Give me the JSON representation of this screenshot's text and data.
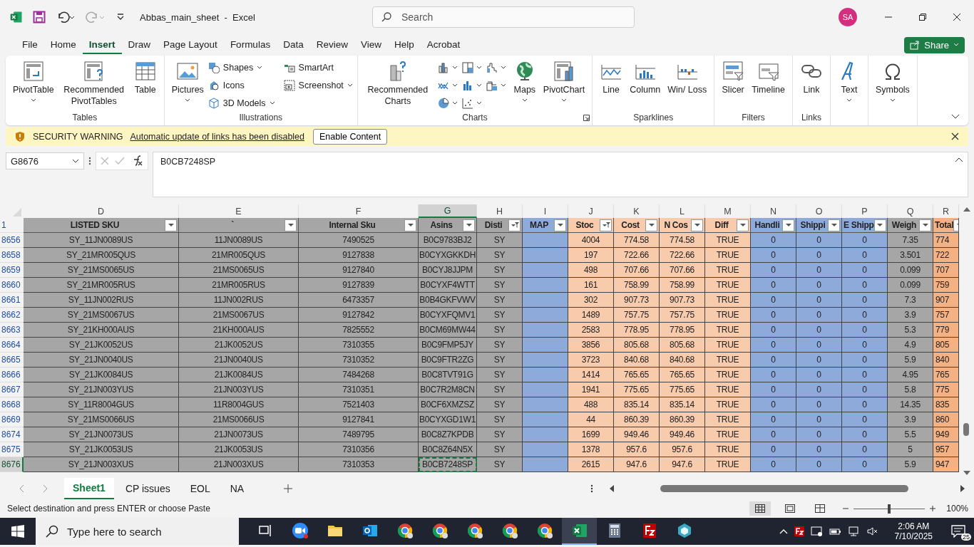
{
  "title_bar": {
    "title": "Abbas_main_sheet  -  Excel",
    "search_placeholder": "Search",
    "avatar": "SA"
  },
  "menu_tabs": [
    {
      "label": "File",
      "selected": false
    },
    {
      "label": "Home",
      "selected": false
    },
    {
      "label": "Insert",
      "selected": true
    },
    {
      "label": "Draw",
      "selected": false
    },
    {
      "label": "Page Layout",
      "selected": false
    },
    {
      "label": "Formulas",
      "selected": false
    },
    {
      "label": "Data",
      "selected": false
    },
    {
      "label": "Review",
      "selected": false
    },
    {
      "label": "View",
      "selected": false
    },
    {
      "label": "Help",
      "selected": false
    },
    {
      "label": "Acrobat",
      "selected": false
    }
  ],
  "share_button": "Share",
  "ribbon": {
    "groups": [
      {
        "label": "Tables",
        "items": [
          {
            "kind": "large",
            "label": "PivotTable",
            "dropdown": true
          },
          {
            "kind": "large",
            "label": "Recommended PivotTables",
            "dropdown": false
          },
          {
            "kind": "large",
            "label": "Table",
            "dropdown": false
          }
        ]
      },
      {
        "label": "Illustrations",
        "items": [
          {
            "kind": "large",
            "label": "Pictures",
            "dropdown": true
          },
          {
            "kind": "small",
            "label": "Shapes",
            "dropdown": true
          },
          {
            "kind": "small",
            "label": "Icons",
            "dropdown": false
          },
          {
            "kind": "small",
            "label": "3D Models",
            "dropdown": true
          },
          {
            "kind": "small",
            "label": "SmartArt",
            "dropdown": false
          },
          {
            "kind": "small",
            "label": "Screenshot",
            "dropdown": true
          }
        ]
      },
      {
        "label": "Charts",
        "launcher": true,
        "items": [
          {
            "kind": "large",
            "label": "Recommended Charts",
            "dropdown": false
          },
          {
            "kind": "gallery"
          },
          {
            "kind": "large",
            "label": "Maps",
            "dropdown": true
          },
          {
            "kind": "large",
            "label": "PivotChart",
            "dropdown": true
          }
        ]
      },
      {
        "label": "Sparklines",
        "items": [
          {
            "kind": "large",
            "label": "Line",
            "dropdown": false
          },
          {
            "kind": "large",
            "label": "Column",
            "dropdown": false
          },
          {
            "kind": "large",
            "label": "Win/ Loss",
            "dropdown": false
          }
        ]
      },
      {
        "label": "Filters",
        "items": [
          {
            "kind": "large",
            "label": "Slicer",
            "dropdown": false
          },
          {
            "kind": "large",
            "label": "Timeline",
            "dropdown": false
          }
        ]
      },
      {
        "label": "Links",
        "items": [
          {
            "kind": "large",
            "label": "Link",
            "dropdown": false
          }
        ]
      },
      {
        "items": [
          {
            "kind": "large",
            "label": "Text",
            "dropdown": true
          }
        ]
      },
      {
        "items": [
          {
            "kind": "large",
            "label": "Symbols",
            "dropdown": true
          }
        ]
      }
    ]
  },
  "security_bar": {
    "title": "SECURITY WARNING",
    "message": "Automatic update of links has been disabled",
    "button": "Enable Content"
  },
  "formula_bar": {
    "name_box": "G8676",
    "value": "B0CB7248SP"
  },
  "sheet": {
    "header_row": "1",
    "columns": [
      {
        "letter": "D",
        "header": "LISTED SKU",
        "color": "#a6a6a6",
        "filtered": false,
        "selected": false
      },
      {
        "letter": "E",
        "header": "`",
        "color": "#a6a6a6",
        "filtered": false,
        "selected": false
      },
      {
        "letter": "F",
        "header": "Internal Sku",
        "color": "#a6a6a6",
        "filtered": false,
        "selected": false
      },
      {
        "letter": "G",
        "header": "Asins",
        "color": "#a6a6a6",
        "filtered": false,
        "selected": true
      },
      {
        "letter": "H",
        "header": "Disti",
        "color": "#a6a6a6",
        "filtered": true,
        "selected": false
      },
      {
        "letter": "I",
        "header": "MAP",
        "color": "#8eaadb",
        "filtered": false,
        "selected": false
      },
      {
        "letter": "J",
        "header": "Stoc",
        "color": "#f8cbad",
        "filtered": true,
        "selected": false
      },
      {
        "letter": "K",
        "header": "Cost",
        "color": "#f8cbad",
        "filtered": false,
        "selected": false
      },
      {
        "letter": "L",
        "header": "N Cos",
        "color": "#f8cbad",
        "filtered": false,
        "selected": false
      },
      {
        "letter": "M",
        "header": "Diff",
        "color": "#f8cbad",
        "filtered": false,
        "selected": false
      },
      {
        "letter": "N",
        "header": "Handli",
        "color": "#8eaadb",
        "filtered": false,
        "selected": false
      },
      {
        "letter": "O",
        "header": "Shippi",
        "color": "#8eaadb",
        "filtered": false,
        "selected": false
      },
      {
        "letter": "P",
        "header": "E Shipp",
        "color": "#8eaadb",
        "filtered": false,
        "selected": false
      },
      {
        "letter": "Q",
        "header": "Weigh",
        "color": "#a6a6a6",
        "filtered": false,
        "selected": false
      },
      {
        "letter": "R",
        "header": "Total",
        "color": "#f4b183",
        "filtered": false,
        "selected": false
      }
    ],
    "rows": [
      {
        "num": "8656",
        "selected": false,
        "cells": [
          "SY_11JN0089US",
          "11JN0089US",
          "7490525",
          "B0C9783BJ2",
          "SY",
          "",
          "4004",
          "774.58",
          "774.58",
          "TRUE",
          "0",
          "0",
          "0",
          "7.35",
          "774"
        ]
      },
      {
        "num": "8658",
        "selected": false,
        "cells": [
          "SY_21MR005QUS",
          "21MR005QUS",
          "9127838",
          "B0CYXGKKDH",
          "SY",
          "",
          "197",
          "722.66",
          "722.66",
          "TRUE",
          "0",
          "0",
          "0",
          "3.501",
          "722"
        ]
      },
      {
        "num": "8659",
        "selected": false,
        "cells": [
          "SY_21MS0065US",
          "21MS0065US",
          "9127840",
          "B0CYJ8JJPM",
          "SY",
          "",
          "498",
          "707.66",
          "707.66",
          "TRUE",
          "0",
          "0",
          "0",
          "0.099",
          "707"
        ]
      },
      {
        "num": "8660",
        "selected": false,
        "cells": [
          "SY_21MR005RUS",
          "21MR005RUS",
          "9127839",
          "B0CYXF4WTT",
          "SY",
          "",
          "161",
          "758.99",
          "758.99",
          "TRUE",
          "0",
          "0",
          "0",
          "0.099",
          "759"
        ]
      },
      {
        "num": "8661",
        "selected": false,
        "cells": [
          "SY_11JN002RUS",
          "11JN002RUS",
          "6473357",
          "B0B4GKFVWV",
          "SY",
          "",
          "302",
          "907.73",
          "907.73",
          "TRUE",
          "0",
          "0",
          "0",
          "7.3",
          "907"
        ]
      },
      {
        "num": "8662",
        "selected": false,
        "cells": [
          "SY_21MS0067US",
          "21MS0067US",
          "9127842",
          "B0CYXFQMV1",
          "SY",
          "",
          "1489",
          "757.75",
          "757.75",
          "TRUE",
          "0",
          "0",
          "0",
          "3.9",
          "757"
        ]
      },
      {
        "num": "8663",
        "selected": false,
        "cells": [
          "SY_21KH000AUS",
          "21KH000AUS",
          "7825552",
          "B0CM69MW44",
          "SY",
          "",
          "2583",
          "778.95",
          "778.95",
          "TRUE",
          "0",
          "0",
          "0",
          "5.3",
          "779"
        ]
      },
      {
        "num": "8664",
        "selected": false,
        "cells": [
          "SY_21JK0052US",
          "21JK0052US",
          "7310355",
          "B0C9FMP5JY",
          "SY",
          "",
          "3856",
          "805.68",
          "805.68",
          "TRUE",
          "0",
          "0",
          "0",
          "4.9",
          "805"
        ]
      },
      {
        "num": "8665",
        "selected": false,
        "cells": [
          "SY_21JN0040US",
          "21JN0040US",
          "7310352",
          "B0C9FTR2ZG",
          "SY",
          "",
          "3723",
          "840.68",
          "840.68",
          "TRUE",
          "0",
          "0",
          "0",
          "5.9",
          "840"
        ]
      },
      {
        "num": "8666",
        "selected": false,
        "cells": [
          "SY_21JK0084US",
          "21JK0084US",
          "7484268",
          "B0C8TVT91G",
          "SY",
          "",
          "1414",
          "765.65",
          "765.65",
          "TRUE",
          "0",
          "0",
          "0",
          "4.95",
          "765"
        ]
      },
      {
        "num": "8667",
        "selected": false,
        "cells": [
          "SY_21JN003YUS",
          "21JN003YUS",
          "7310351",
          "B0C7R2M8CN",
          "SY",
          "",
          "1941",
          "775.65",
          "775.65",
          "TRUE",
          "0",
          "0",
          "0",
          "5.8",
          "775"
        ]
      },
      {
        "num": "8668",
        "selected": false,
        "cells": [
          "SY_11R8004GUS",
          "11R8004GUS",
          "7521403",
          "B0CF6XMZSZ",
          "SY",
          "",
          "488",
          "835.14",
          "835.14",
          "TRUE",
          "0",
          "0",
          "0",
          "14.35",
          "835"
        ]
      },
      {
        "num": "8669",
        "selected": false,
        "cells": [
          "SY_21MS0066US",
          "21MS0066US",
          "9127841",
          "B0CYXGD1W1",
          "SY",
          "",
          "44",
          "860.39",
          "860.39",
          "TRUE",
          "0",
          "0",
          "0",
          "3.9",
          "860"
        ]
      },
      {
        "num": "8674",
        "selected": false,
        "cells": [
          "SY_21JN0073US",
          "21JN0073US",
          "7489795",
          "B0C8Z7KPDB",
          "SY",
          "",
          "1699",
          "949.46",
          "949.46",
          "TRUE",
          "0",
          "0",
          "0",
          "5.5",
          "949"
        ]
      },
      {
        "num": "8675",
        "selected": false,
        "cells": [
          "SY_21JK0053US",
          "21JK0053US",
          "7310356",
          "B0C8Z64N5X",
          "SY",
          "",
          "1378",
          "957.6",
          "957.6",
          "TRUE",
          "0",
          "0",
          "0",
          "5",
          "957"
        ]
      },
      {
        "num": "8676",
        "selected": true,
        "cells": [
          "SY_21JN003XUS",
          "21JN003XUS",
          "7310353",
          "B0CB7248SP",
          "SY",
          "",
          "2615",
          "947.6",
          "947.6",
          "TRUE",
          "0",
          "0",
          "0",
          "5.9",
          "947"
        ]
      }
    ]
  },
  "sheet_tabs": [
    {
      "label": "Sheet1",
      "selected": true
    },
    {
      "label": "CP issues",
      "selected": false
    },
    {
      "label": "EOL",
      "selected": false
    },
    {
      "label": "NA",
      "selected": false
    }
  ],
  "status_bar": {
    "message": "Select destination and press ENTER or choose Paste",
    "views": [
      {
        "selected": true
      },
      {
        "selected": false
      },
      {
        "selected": false
      }
    ],
    "zoom": {
      "level": 0.5,
      "label": "100%"
    }
  },
  "taskbar": {
    "search_placeholder": "Type here to search",
    "apps": [
      {
        "kind": "task-view",
        "selected": false
      },
      {
        "kind": "zoom",
        "selected": false
      },
      {
        "kind": "folder",
        "selected": false
      },
      {
        "kind": "outlook",
        "selected": false
      },
      {
        "kind": "chrome",
        "selected": false
      },
      {
        "kind": "chrome",
        "selected": false
      },
      {
        "kind": "chrome",
        "selected": false
      },
      {
        "kind": "chrome",
        "selected": false
      },
      {
        "kind": "chrome",
        "selected": false
      },
      {
        "kind": "excel",
        "selected": true
      },
      {
        "kind": "calculator",
        "selected": false
      },
      {
        "kind": "filezilla",
        "selected": false
      },
      {
        "kind": "cube",
        "selected": false
      }
    ],
    "time": "2:06 AM",
    "date": "7/10/2025",
    "notifications": "25"
  }
}
